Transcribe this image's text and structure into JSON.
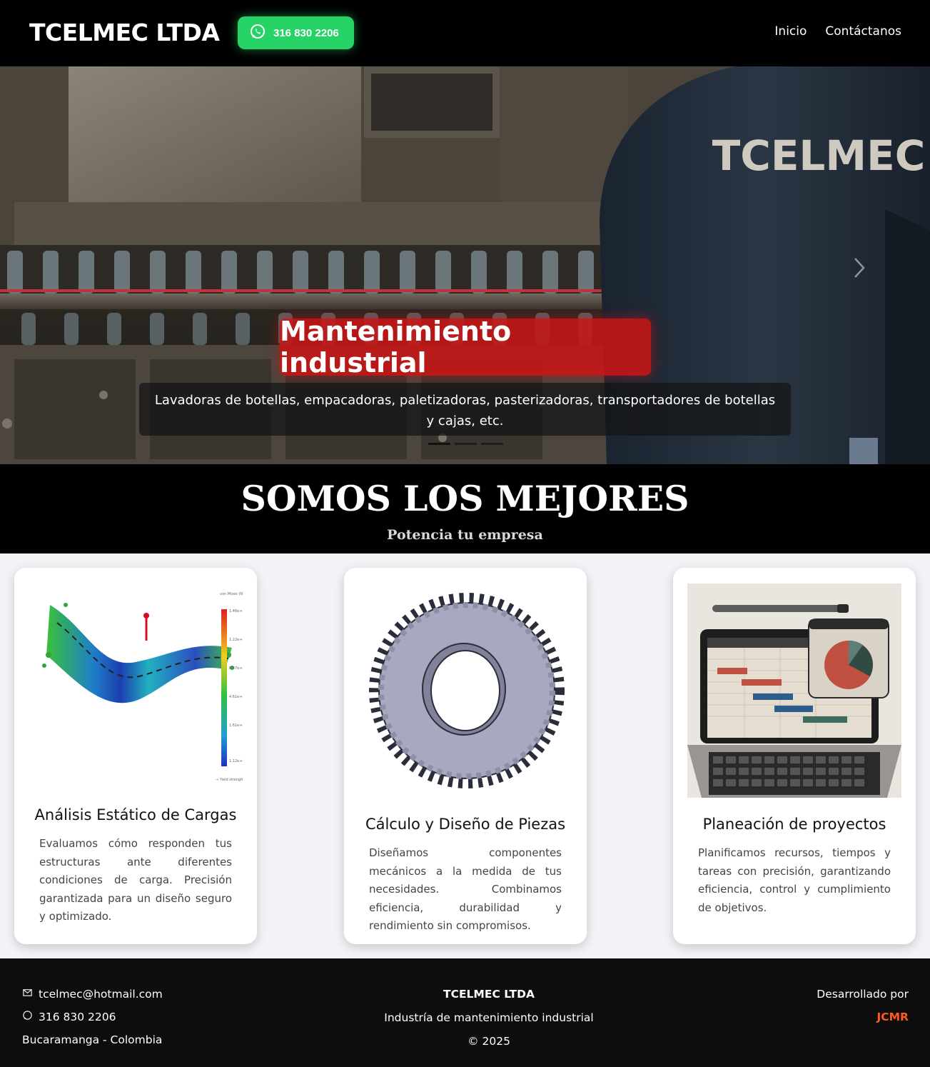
{
  "nav": {
    "brand": "TCELMEC LTDA",
    "whatsapp": "316 830 2206",
    "links": [
      "Inicio",
      "Contáctanos"
    ]
  },
  "hero": {
    "title": "Mantenimiento industrial",
    "subtitle": "Lavadoras de botellas, empacadoras, paletizadoras, pasterizadoras, transportadores de botellas y cajas, etc.",
    "jacket_text": "TCELMEC",
    "slides": 3,
    "active_slide": 1
  },
  "about": {
    "title": "SOMOS LOS MEJORES",
    "subtitle": "Potencia tu empresa"
  },
  "cards": [
    {
      "title": "Análisis Estático de Cargas",
      "text": "Evaluamos cómo responden tus estructuras ante diferentes condiciones de carga. Precisión garantizada para un diseño seguro y optimizado.",
      "icon": "stress-analysis-image"
    },
    {
      "title": "Cálculo y Diseño de Piezas",
      "text": "Diseñamos componentes mecánicos a la medida de tus necesidades. Combinamos eficiencia, durabilidad y rendimiento sin compromisos.",
      "icon": "gear-part-image"
    },
    {
      "title": "Planeación de proyectos",
      "text": "Planificamos recursos, tiempos y tareas con precisión, garantizando eficiencia, control y cumplimiento de objetivos.",
      "icon": "laptop-gantt-image"
    }
  ],
  "footer": {
    "email": "tcelmec@hotmail.com",
    "phone": "316 830 2206",
    "location": "Bucaramanga - Colombia",
    "company": "TCELMEC LTDA",
    "tagline": "Industría de mantenimiento industrial",
    "copyright": "© 2025",
    "dev_label": "Desarrollado por",
    "dev_name": "JCMR"
  },
  "colors": {
    "whatsapp": "#25d366",
    "hero_title_bg": "#c81616",
    "dev_accent": "#ff5a1f"
  }
}
